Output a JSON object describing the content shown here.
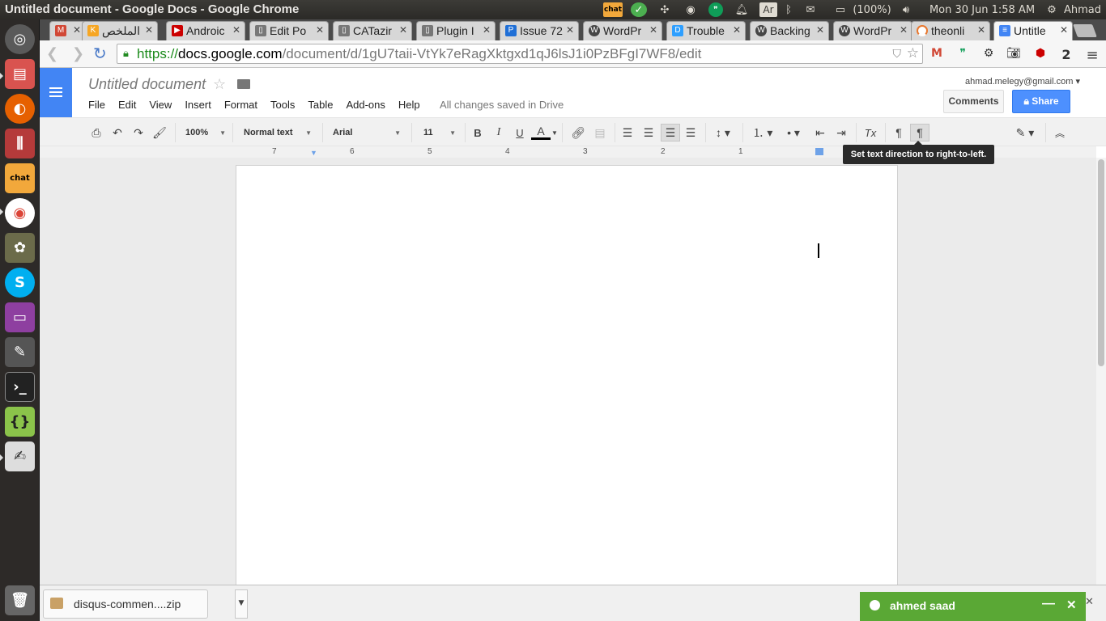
{
  "system": {
    "window_title": "Untitled document - Google Docs - Google Chrome",
    "battery": "(100%)",
    "datetime": "Mon 30 Jun  1:58 AM",
    "user": "Ahmad",
    "lang_indicator": "Ar",
    "chat_indicator": "chat"
  },
  "launcher": {
    "chat_label": "chat"
  },
  "tabs": [
    {
      "label": "",
      "icon": "gmail-icon",
      "color": "#d14836"
    },
    {
      "label": "الملخص",
      "icon": "k-icon",
      "color": "#f6a623"
    },
    {
      "label": "Androic",
      "icon": "youtube-icon",
      "color": "#cc0000"
    },
    {
      "label": "Edit Po",
      "icon": "doc-icon",
      "color": "#777777"
    },
    {
      "label": "CATazir",
      "icon": "doc-icon",
      "color": "#777777"
    },
    {
      "label": "Plugin I",
      "icon": "doc-icon",
      "color": "#777777"
    },
    {
      "label": "Issue 72",
      "icon": "p-icon",
      "color": "#1f6fd6"
    },
    {
      "label": "WordPr",
      "icon": "wordpress-icon",
      "color": "#464646"
    },
    {
      "label": "Trouble",
      "icon": "d-icon",
      "color": "#2e9fff"
    },
    {
      "label": "Backing",
      "icon": "wordpress-icon",
      "color": "#464646"
    },
    {
      "label": "WordPr",
      "icon": "wordpress-icon",
      "color": "#464646"
    },
    {
      "label": "theonli",
      "icon": "loading-icon",
      "color": "#e8772e"
    },
    {
      "label": "Untitle",
      "icon": "docs-icon",
      "color": "#4285f4"
    }
  ],
  "browser": {
    "url_https": "https://",
    "url_host": "docs.google.com",
    "url_path": "/document/d/1gU7taii-VtYk7eRagXktgxd1qJ6lsJ1i0PzBFgI7WF8/edit",
    "ext_badge": "2"
  },
  "docs": {
    "title": "Untitled document",
    "menu": [
      "File",
      "Edit",
      "View",
      "Insert",
      "Format",
      "Tools",
      "Table",
      "Add-ons",
      "Help"
    ],
    "save_status": "All changes saved in Drive",
    "account": "ahmad.melegy@gmail.com",
    "comments_label": "Comments",
    "share_label": "Share"
  },
  "toolbar": {
    "zoom": "100%",
    "style": "Normal text",
    "font": "Arial",
    "size": "11",
    "bold": "B",
    "italic": "I",
    "underline": "U",
    "text_color": "A",
    "clear_format": "Tx",
    "tooltip": "Set text direction to right-to-left."
  },
  "ruler": [
    "7",
    "6",
    "5",
    "4",
    "3",
    "2",
    "1"
  ],
  "downloads": {
    "file": "disqus-commen....zip"
  },
  "chat": {
    "name": "ahmed saad",
    "color": "#5aa835"
  }
}
